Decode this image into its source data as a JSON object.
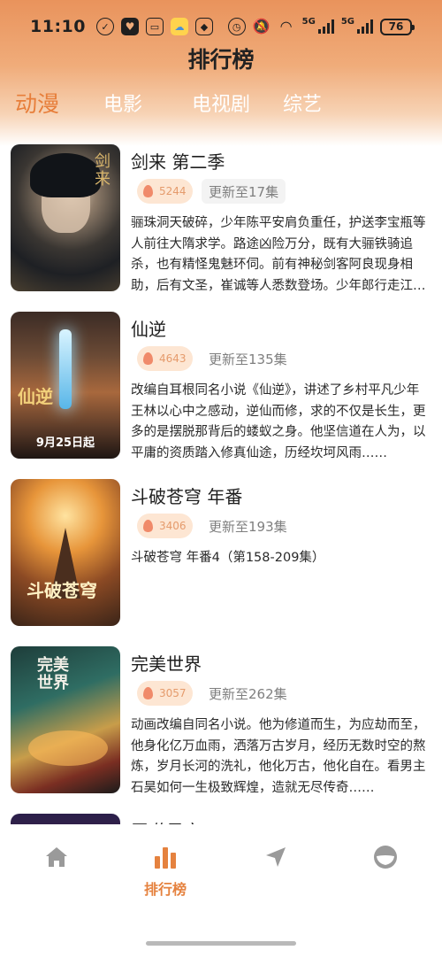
{
  "status_bar": {
    "time": "11:10",
    "network_1": "5G",
    "network_2": "5G",
    "battery": "76"
  },
  "header": {
    "title": "排行榜"
  },
  "tabs": [
    {
      "label": "动漫",
      "active": true
    },
    {
      "label": "电影",
      "active": false
    },
    {
      "label": "电视剧",
      "active": false
    },
    {
      "label": "综艺",
      "active": false
    }
  ],
  "items": [
    {
      "title": "剑来 第二季",
      "heat": "5244",
      "update": "更新至17集",
      "desc": "骊珠洞天破碎，少年陈平安肩负重任，护送李宝瓶等人前往大隋求学。路途凶险万分，既有大骊铁骑追杀，也有精怪鬼魅环伺。前有神秘剑客阿良现身相助，后有文圣，崔诚等人悉数登场。少年郎行走江湖……",
      "poster_text": ""
    },
    {
      "title": "仙逆",
      "heat": "4643",
      "update": "更新至135集",
      "desc": "改编自耳根同名小说《仙逆》，讲述了乡村平凡少年王林以心中之感动，逆仙而修，求的不仅是长生，更多的是摆脱那背后的蝼蚁之身。他坚信道在人为，以平庸的资质踏入修真仙途，历经坎坷风雨……",
      "poster_text": "9月25日起"
    },
    {
      "title": "斗破苍穹 年番",
      "heat": "3406",
      "update": "更新至193集",
      "desc": "斗破苍穹 年番4（第158-209集）",
      "poster_text": ""
    },
    {
      "title": "完美世界",
      "heat": "3057",
      "update": "更新至262集",
      "desc": "动画改编自同名小说。他为修道而生，为应劫而至，他身化亿万血雨，洒落万古岁月，经历无数时空的熬炼，岁月长河的洗礼，他化万古，他化自在。看男主石昊如何一生极致辉煌，造就无尽传奇……",
      "poster_text": ""
    },
    {
      "title": "吞噬星空",
      "heat": "",
      "update": "",
      "desc": "",
      "poster_text": ""
    }
  ],
  "bottom_nav": [
    {
      "label": "",
      "icon": "home-icon"
    },
    {
      "label": "排行榜",
      "icon": "ranking-icon"
    },
    {
      "label": "",
      "icon": "discover-icon"
    },
    {
      "label": "",
      "icon": "profile-icon"
    }
  ],
  "colors": {
    "accent": "#e5823f",
    "header_top": "#e9935c",
    "heat_bg": "#fde6d3"
  }
}
